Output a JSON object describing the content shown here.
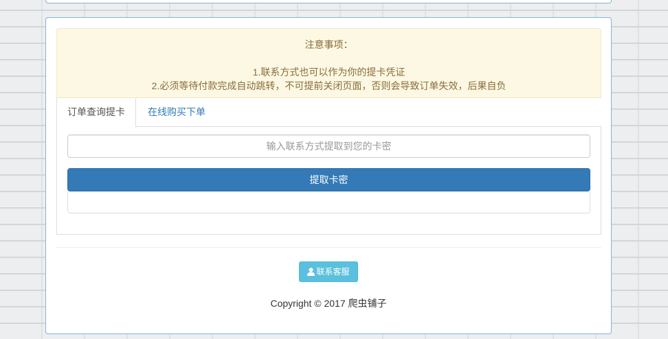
{
  "notice": {
    "title": "注意事项：",
    "line1": "1.联系方式也可以作为你的提卡凭证",
    "line2": "2.必须等待付款完成自动跳转，不可提前关闭页面，否则会导致订单失效，后果自负"
  },
  "tabs": [
    {
      "label": "订单查询提卡",
      "active": true
    },
    {
      "label": "在线购买下单",
      "active": false
    }
  ],
  "query": {
    "placeholder": "输入联系方式提取到您的卡密",
    "value": "",
    "submit_label": "提取卡密"
  },
  "footer": {
    "contact_label": "联系客服",
    "contact_icon": "user-icon",
    "copyright": "Copyright © 2017 爬虫铺子"
  },
  "colors": {
    "primary": "#337ab7",
    "info": "#5bc0de",
    "warning_bg": "#fcf8e3",
    "warning_text": "#8a6d3b",
    "panel_border": "#7fb2d9"
  }
}
